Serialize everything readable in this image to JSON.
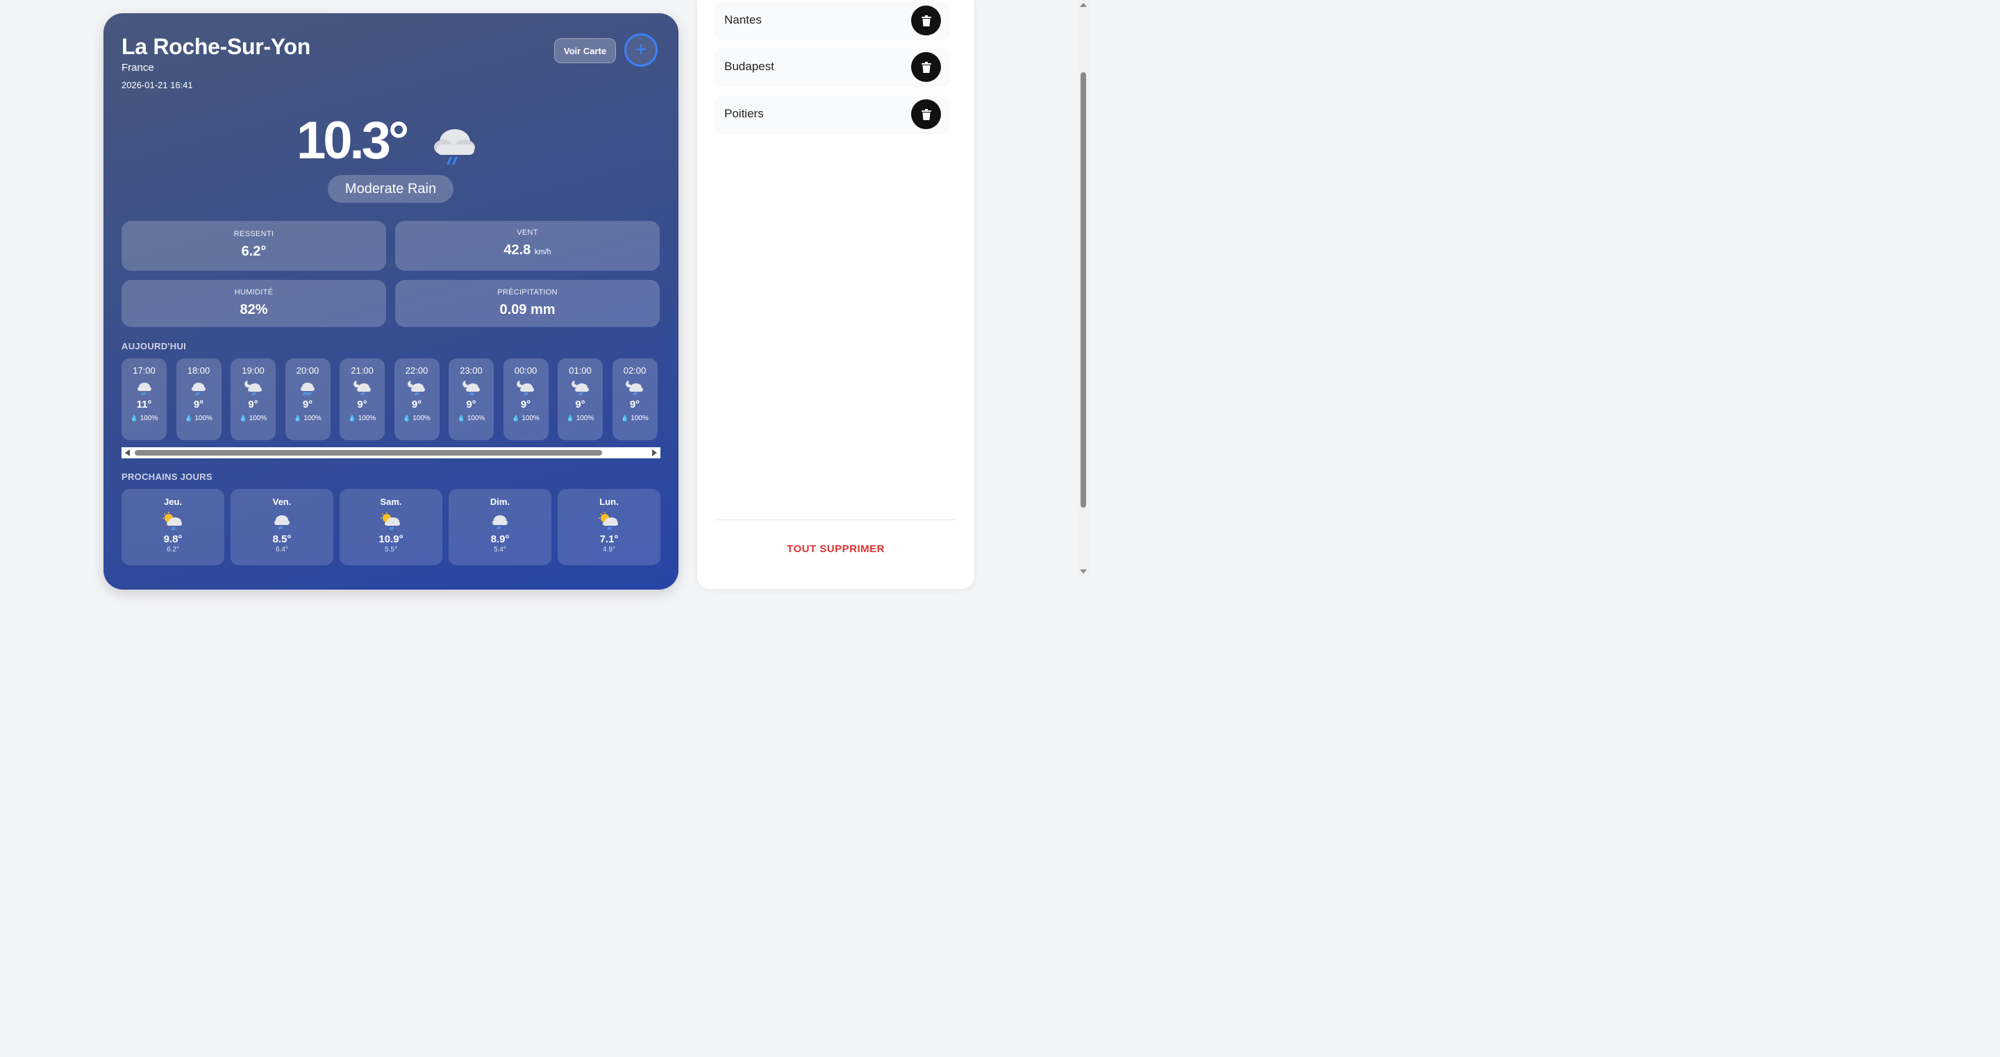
{
  "weather": {
    "city": "La Roche-Sur-Yon",
    "country": "France",
    "datetime": "2026-01-21 16:41",
    "map_button": "Voir Carte",
    "add_button": "+",
    "temperature": "10.3°",
    "condition": "Moderate Rain",
    "condition_icon": "rain-cloud-icon",
    "stats": {
      "feels_like": {
        "label": "RESSENTI",
        "value": "6.2°"
      },
      "wind": {
        "label": "VENT",
        "value": "42.8",
        "unit": "km/h"
      },
      "humidity": {
        "label": "HUMIDITÉ",
        "value": "82%"
      },
      "precipitation": {
        "label": "PRÉCIPITATION",
        "value": "0.09 mm"
      }
    },
    "today_title": "AUJOURD'HUI",
    "hourly": [
      {
        "time": "17:00",
        "temp": "11°",
        "precip": "100%",
        "icon": "rain-cloud-icon"
      },
      {
        "time": "18:00",
        "temp": "9°",
        "precip": "100%",
        "icon": "rain-cloud-icon"
      },
      {
        "time": "19:00",
        "temp": "9°",
        "precip": "100%",
        "icon": "night-rain-icon"
      },
      {
        "time": "20:00",
        "temp": "9°",
        "precip": "100%",
        "icon": "rain-cloud-icon"
      },
      {
        "time": "21:00",
        "temp": "9°",
        "precip": "100%",
        "icon": "night-rain-icon"
      },
      {
        "time": "22:00",
        "temp": "9°",
        "precip": "100%",
        "icon": "night-rain-icon"
      },
      {
        "time": "23:00",
        "temp": "9°",
        "precip": "100%",
        "icon": "night-rain-icon"
      },
      {
        "time": "00:00",
        "temp": "9°",
        "precip": "100%",
        "icon": "night-rain-icon"
      },
      {
        "time": "01:00",
        "temp": "9°",
        "precip": "100%",
        "icon": "night-rain-icon"
      },
      {
        "time": "02:00",
        "temp": "9°",
        "precip": "100%",
        "icon": "night-rain-icon"
      }
    ],
    "next_days_title": "PROCHAINS JOURS",
    "daily": [
      {
        "day": "Jeu.",
        "high": "9.8°",
        "low": "6.2°",
        "icon": "sun-rain-icon"
      },
      {
        "day": "Ven.",
        "high": "8.5°",
        "low": "6.4°",
        "icon": "rain-cloud-icon"
      },
      {
        "day": "Sam.",
        "high": "10.9°",
        "low": "5.5°",
        "icon": "sun-rain-icon"
      },
      {
        "day": "Dim.",
        "high": "8.9°",
        "low": "5.4°",
        "icon": "rain-cloud-icon"
      },
      {
        "day": "Lun.",
        "high": "7.1°",
        "low": "4.9°",
        "icon": "sun-rain-icon"
      }
    ]
  },
  "saved_cities": {
    "items": [
      {
        "name": "Nantes",
        "delete_icon": "trash-icon"
      },
      {
        "name": "Budapest",
        "delete_icon": "trash-icon"
      },
      {
        "name": "Poitiers",
        "delete_icon": "trash-icon"
      }
    ],
    "clear_all": "TOUT SUPPRIMER"
  },
  "colors": {
    "accent": "#3b82f6",
    "danger": "#e03131",
    "card_gradient_start": "#48577d",
    "card_gradient_end": "#2845a6"
  }
}
